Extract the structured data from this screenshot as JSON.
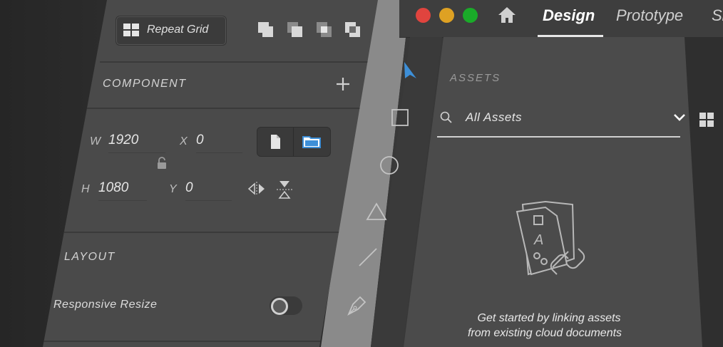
{
  "inspector": {
    "repeat_grid_label": "Repeat Grid",
    "component_title": "COMPONENT",
    "w_label": "W",
    "w_value": "1920",
    "x_label": "X",
    "x_value": "0",
    "h_label": "H",
    "h_value": "1080",
    "y_label": "Y",
    "y_value": "0",
    "layout_title": "LAYOUT",
    "responsive_resize_label": "Responsive Resize",
    "responsive_resize_on": false
  },
  "window": {
    "tabs": [
      "Design",
      "Prototype",
      "Sh"
    ],
    "active_tab": "Design",
    "traffic_colors": [
      "#e0443e",
      "#dea123",
      "#1aab29"
    ]
  },
  "assets": {
    "title": "ASSETS",
    "search_value": "All Assets",
    "empty_message_line1": "Get started by linking assets",
    "empty_message_line2": "from existing cloud documents"
  },
  "colors": {
    "accent": "#3d8fd8",
    "panel": "#4a4a4a"
  }
}
